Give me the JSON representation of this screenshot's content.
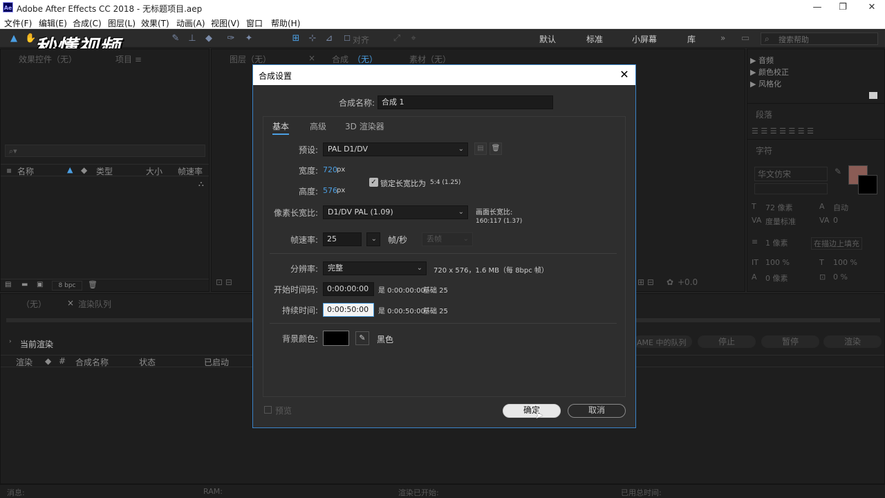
{
  "app": {
    "logo": "Ae",
    "title": "Adobe After Effects CC 2018 - 无标题项目.aep"
  },
  "window_controls": {
    "minimize": "—",
    "maximize": "❐",
    "close": "✕"
  },
  "menu": [
    "文件(F)",
    "编辑(E)",
    "合成(C)",
    "图层(L)",
    "效果(T)",
    "动画(A)",
    "视图(V)",
    "窗口",
    "帮助(H)"
  ],
  "toolbar": {
    "snap_label": "对齐",
    "workspaces": [
      "默认",
      "标准",
      "小屏幕",
      "库"
    ],
    "more": "»",
    "search_placeholder": "搜索帮助"
  },
  "watermark": "秒懂视频",
  "project_panel": {
    "tab_effects": "效果控件（无）",
    "tab_project": "项目 ≡",
    "columns": [
      "名称",
      "类型",
      "大小",
      "帧速率"
    ],
    "bpc": "8 bpc"
  },
  "viewer": {
    "tab_layer": "图层（无）",
    "tab_comp": "合成",
    "tab_comp_state": "（无）",
    "tab_footage": "素材（无）",
    "exposure": "+0.0"
  },
  "right_panel": {
    "effects": [
      "音频",
      "颜色校正",
      "风格化"
    ],
    "paragraph_title": "段落",
    "character_title": "字符",
    "font_name": "华文仿宋",
    "font_size": "72 像素",
    "leading": "自动",
    "kerning": "度量标准",
    "tracking": "0",
    "stroke": "1 像素",
    "stroke_mode": "在描边上填充",
    "v_scale": "100 %",
    "h_scale": "100 %",
    "baseline": "0 像素",
    "tsume": "0 %",
    "fill_color": "#8a5c55"
  },
  "render_queue": {
    "tab_none": "（无）",
    "tab_render": "渲染队列",
    "current_render": "当前渲染",
    "ame_queue": "AME 中的队列",
    "stop": "停止",
    "pause": "暂停",
    "render": "渲染",
    "columns": [
      "渲染",
      "#",
      "合成名称",
      "状态",
      "已启动"
    ]
  },
  "status_bar": {
    "message": "消息:",
    "ram": "RAM:",
    "renders_started": "渲染已开始:",
    "total_time": "已用总时间:"
  },
  "dialog": {
    "title": "合成设置",
    "comp_name_label": "合成名称:",
    "comp_name": "合成 1",
    "tabs": [
      "基本",
      "高级",
      "3D 渲染器"
    ],
    "active_tab": "基本",
    "preset_label": "预设:",
    "preset": "PAL D1/DV",
    "width_label": "宽度:",
    "width": "720",
    "height_label": "高度:",
    "height": "576",
    "px": "px",
    "lock_aspect": "锁定长宽比为",
    "lock_aspect_value": "5:4 (1.25)",
    "pixel_aspect_label": "像素长宽比:",
    "pixel_aspect": "D1/DV PAL (1.09)",
    "frame_aspect_label": "画面长宽比:",
    "frame_aspect": "160:117 (1.37)",
    "frame_rate_label": "帧速率:",
    "frame_rate": "25",
    "fps_unit": "帧/秒",
    "drop_frame": "丢帧",
    "resolution_label": "分辨率:",
    "resolution": "完整",
    "resolution_info": "720 x 576，1.6 MB（每 8bpc 帧）",
    "start_tc_label": "开始时间码:",
    "start_tc": "0:00:00:00",
    "start_tc_info": "是 0:00:00:00",
    "start_base": "基础 25",
    "duration_label": "持续时间:",
    "duration": "0:00:50:00",
    "duration_info": "是 0:00:50:00",
    "duration_base": "基础 25",
    "bg_color_label": "背景颜色:",
    "bg_color": "#000000",
    "bg_color_name": "黑色",
    "preview": "预览",
    "ok": "确定",
    "cancel": "取消"
  }
}
